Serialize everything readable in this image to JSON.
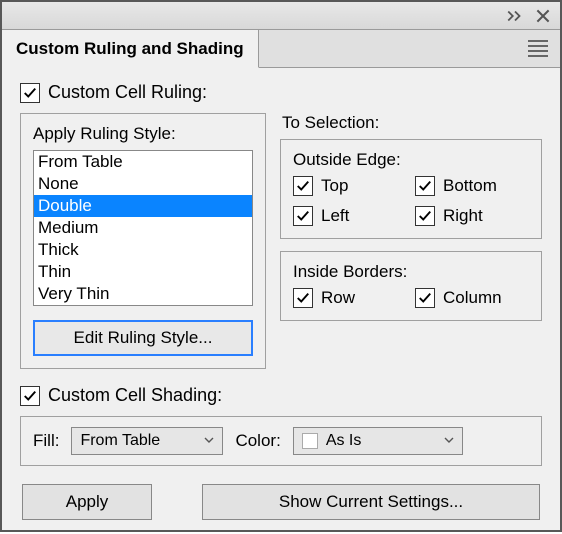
{
  "tab_title": "Custom Ruling and Shading",
  "ruling_section": {
    "label": "Custom Cell Ruling:",
    "checked": true
  },
  "apply_style": {
    "label": "Apply Ruling Style:",
    "items": [
      "From Table",
      "None",
      "Double",
      "Medium",
      "Thick",
      "Thin",
      "Very Thin"
    ],
    "selected_index": 2,
    "edit_button": "Edit Ruling Style..."
  },
  "to_selection": {
    "label": "To Selection:",
    "outside": {
      "label": "Outside Edge:",
      "top": {
        "label": "Top",
        "checked": true
      },
      "bottom": {
        "label": "Bottom",
        "checked": true
      },
      "left": {
        "label": "Left",
        "checked": true
      },
      "right": {
        "label": "Right",
        "checked": true
      }
    },
    "inside": {
      "label": "Inside Borders:",
      "row": {
        "label": "Row",
        "checked": true
      },
      "column": {
        "label": "Column",
        "checked": true
      }
    }
  },
  "shading_section": {
    "label": "Custom Cell Shading:",
    "checked": true
  },
  "shading_controls": {
    "fill_label": "Fill:",
    "fill_value": "From Table",
    "color_label": "Color:",
    "color_value": "As Is"
  },
  "buttons": {
    "apply": "Apply",
    "show": "Show Current Settings..."
  }
}
